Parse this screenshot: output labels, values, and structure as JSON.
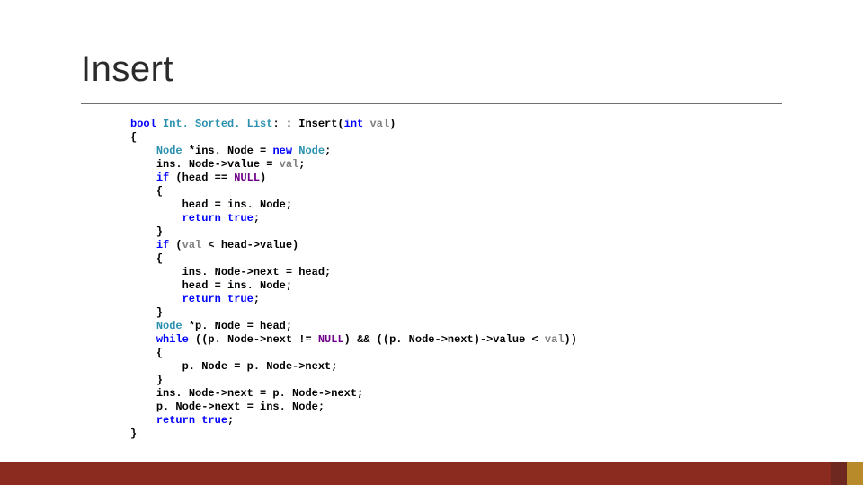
{
  "title": "Insert",
  "code": {
    "l01": "bool Int. Sorted. List: : Insert(int val)",
    "l01_kw1": "bool",
    "l01_type": "Int. Sorted. List",
    "l01_kw2": "int",
    "l01_id": "val",
    "l02": "{",
    "l03_type": "Node",
    "l03_rest": " *ins. Node = ",
    "l03_kw": "new",
    "l03_type2": " Node",
    "l03_end": ";",
    "l04": "ins. Node->value = ",
    "l04_id": "val",
    "l04_end": ";",
    "l05_kw": "if",
    "l05_cond": " (head == ",
    "l05_lit": "NULL",
    "l05_end": ")",
    "l06": "{",
    "l07": "head = ins. Node;",
    "l08_kw": "return",
    "l08_lit": " true",
    "l08_end": ";",
    "l09": "}",
    "l10_kw": "if",
    "l10_cond": " (",
    "l10_id": "val",
    "l10_rest": " < head->value)",
    "l11": "{",
    "l12": "ins. Node->next = head;",
    "l13": "head = ins. Node;",
    "l14_kw": "return",
    "l14_lit": " true",
    "l14_end": ";",
    "l15": "}",
    "l16_type": "Node",
    "l16_rest": " *p. Node = head;",
    "l17_kw": "while",
    "l17_a": " ((p. Node->next != ",
    "l17_lit": "NULL",
    "l17_b": ") && ((p. Node->next)->value < ",
    "l17_id": "val",
    "l17_end": "))",
    "l18": "{",
    "l19": "p. Node = p. Node->next;",
    "l20": "}",
    "l21": "ins. Node->next = p. Node->next;",
    "l22": "p. Node->next = ins. Node;",
    "l23_kw": "return",
    "l23_lit": " true",
    "l23_end": ";",
    "l24": "}"
  }
}
